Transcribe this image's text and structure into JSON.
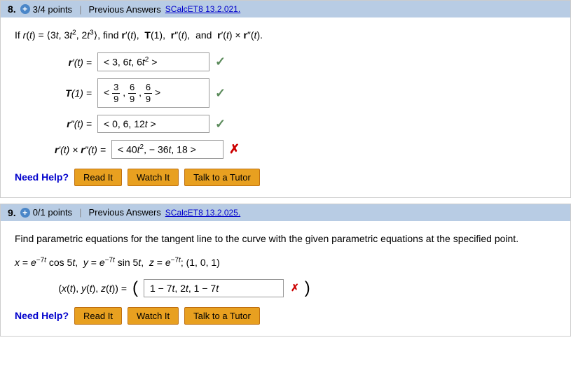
{
  "questions": [
    {
      "number": "8.",
      "points": "3/4 points",
      "prev_answers_label": "Previous Answers",
      "source": "SCalcET8 13.2.021.",
      "problem_html": "If <i>r</i>(<i>t</i>) = ⟨3<i>t</i>, 3<i>t</i><sup>2</sup>, 2<i>t</i><sup>3</sup>⟩, find <b>r</b>′(<i>t</i>), <b>T</b>(1), <b>r</b>″(<i>t</i>), and <b>r</b>′(<i>t</i>) × <b>r</b>″(<i>t</i>).",
      "rows": [
        {
          "label": "r′(t) =",
          "value": "⟨ 3, 6t, 6t² ⟩",
          "status": "correct"
        },
        {
          "label": "T(1) =",
          "value": "⟨ 3/9, 6/9, 6/9 ⟩",
          "status": "correct",
          "isFraction": true
        },
        {
          "label": "r″(t) =",
          "value": "⟨ 0, 6, 12t ⟩",
          "status": "correct"
        },
        {
          "label": "r′(t) × r″(t) =",
          "value": "⟨ 40t², −36t, 18 ⟩",
          "status": "wrong"
        }
      ],
      "need_help": "Need Help?",
      "buttons": [
        "Read It",
        "Watch It",
        "Talk to a Tutor"
      ]
    },
    {
      "number": "9.",
      "points": "0/1 points",
      "prev_answers_label": "Previous Answers",
      "source": "SCalcET8 13.2.025.",
      "statement": "Find parametric equations for the tangent line to the curve with the given parametric equations at the specified point.",
      "sub_eq": "x = e⁻⁷ᵗ cos 5t, y = e⁻⁷ᵗ sin 5t, z = e⁻⁷ᵗ; (1, 0, 1)",
      "answer_label": "(x(t), y(t), z(t)) =",
      "answer_value": "1 − 7t, 2t, 1 − 7t",
      "answer_status": "wrong",
      "need_help": "Need Help?",
      "buttons": [
        "Read It",
        "Watch It",
        "Talk to a Tutor"
      ]
    }
  ]
}
